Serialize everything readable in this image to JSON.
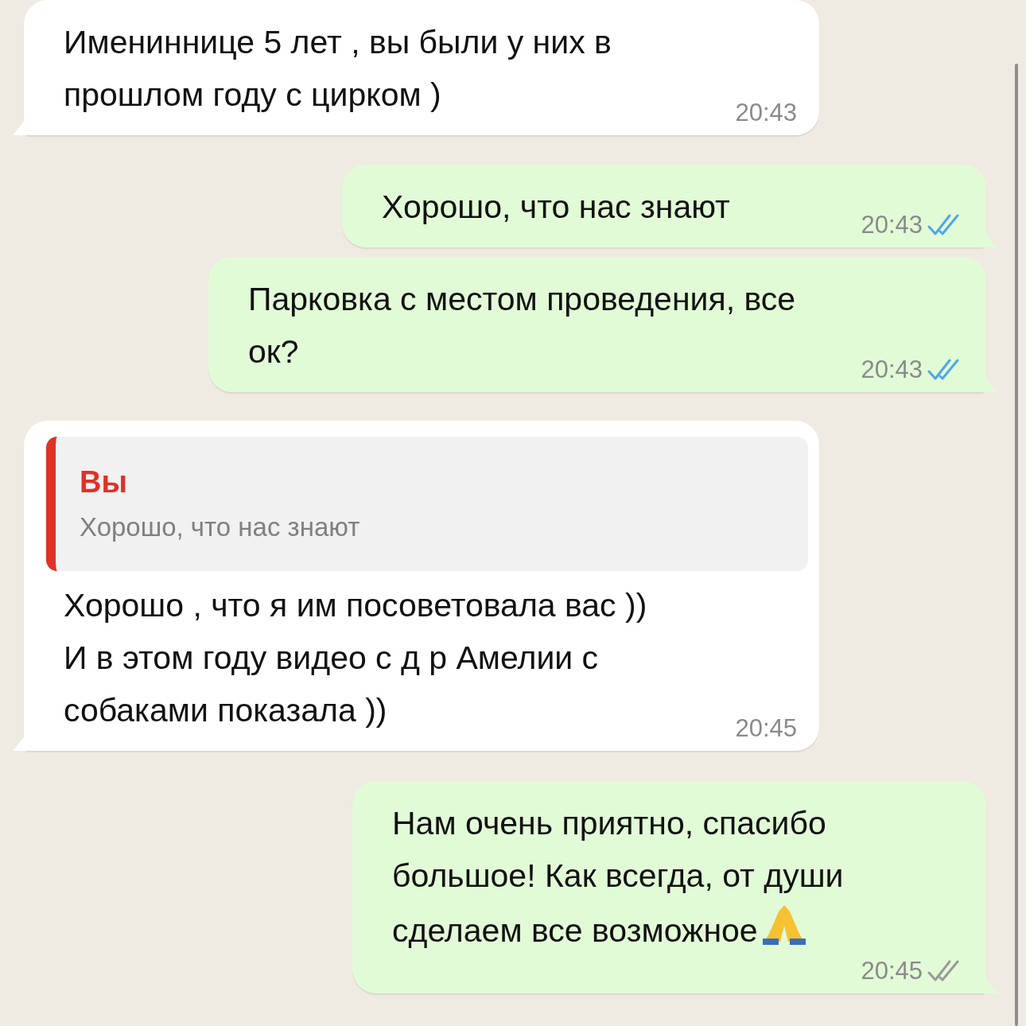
{
  "messages": [
    {
      "kind": "incoming",
      "text": "Имениннице 5 лет , вы были у них в\nпрошлом году с цирком )",
      "time": "20:43"
    },
    {
      "kind": "outgoing",
      "text": "Хорошо, что нас знают",
      "time": "20:43",
      "read": true
    },
    {
      "kind": "outgoing",
      "text": "Парковка с местом проведения, все\nок?",
      "time": "20:43",
      "read": true
    },
    {
      "kind": "incoming",
      "reply": {
        "author": "Вы",
        "text": "Хорошо, что нас знают"
      },
      "text": "Хорошо , что я им посоветовала вас ))\nИ в этом году видео с д р Амелии с\nсобаками показала ))",
      "time": "20:45"
    },
    {
      "kind": "outgoing",
      "text": "Нам очень приятно, спасибо\nбольшое! Как всегда, от души\nсделаем все возможное",
      "icons": [
        {
          "kind": "pray"
        }
      ],
      "time": "20:45",
      "read": false
    }
  ]
}
